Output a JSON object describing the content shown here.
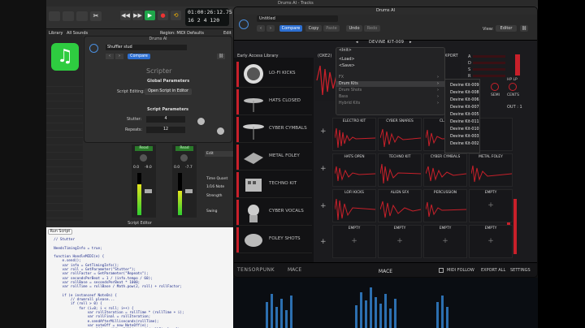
{
  "menubar": {
    "title": "Drums AI - Tracks"
  },
  "daw": {
    "lcd_time": "01:00:26:12.75",
    "lcd_sub": "16  2  4 120",
    "library_label": "Library",
    "all_sounds": "All Sounds",
    "region_label": "Region: MIDI Defaults",
    "edit_label": "Edit",
    "read1": "Read",
    "read2": "Read",
    "val1": "0.0",
    "val2": "-9.0",
    "val3": "0.0",
    "val4": "-7.7",
    "side_time_quant": "Time Quant",
    "side_note": "1/16 Note",
    "side_strength": "Strength",
    "side_swing": "Swing"
  },
  "scripter": {
    "window_title": "Drums AI",
    "preset": "Shuffler stud",
    "compare": "Compare",
    "heading": "Scripter",
    "global_params": "Global Parameters",
    "script_editing_label": "Script Editing:",
    "open_script_btn": "Open Script in Editor",
    "script_params": "Script Parameters",
    "stutter_label": "Stutter:",
    "stutter_value": "4",
    "repeats_label": "Repeats:",
    "repeats_value": "12"
  },
  "script_editor": {
    "title": "Script Editor",
    "run_button": "Run Script",
    "code": "  // Stutter\n\n  NeedsTimingInfo = true;\n\n  function HandleMIDI(e) {\n      e.send();\n      var info = GetTimingInfo();\n      var roll = GetParameter(\"Stutter\");\n      var rollFactor = GetParameter(\"Repeats\");\n      var secondsPerBeat = 1 / (info.tempo / 60);\n      var rollBase = secondsPerBeat * 1000;\n      var rollTime = rollBase / Math.pow(2, roll) + rollFactor;\n\n      if (e instanceof NoteOn) {\n          // drumroll please...\n          if (roll > 0) {\n              for (i=0; i < roll; i++) {\n                  var rollIteration = rollTime * (rollTime + i);\n                  var rollFinal = rollIteration;\n                  e.sendAfterMilliseconds(rollTime);\n                  var noteOff = new NoteOff(e);\n                  noteOff.sendAfterMilliseconds(rollFinal + 1);"
  },
  "plugin": {
    "window_title": "Drums AI",
    "preset": "Untitled",
    "compare": "Compare",
    "copy": "Copy",
    "paste": "Paste",
    "undo": "Undo",
    "redo": "Redo",
    "view_label": "View:",
    "view_value": "Editor",
    "kit_name": "DEVINE KIT-009",
    "early_access": "Early Access Library",
    "kit_slot": "(OXE2)",
    "export": "EXPORT",
    "adsr": [
      "A",
      "D",
      "S",
      "R"
    ],
    "hp_lp": "HP LP",
    "knobs": [
      "SEMI",
      "CENTS"
    ],
    "out": "OUT : 1",
    "categories": [
      {
        "label": "LO-FI KICKS",
        "icon": "drum-icon"
      },
      {
        "label": "HATS CLOSED",
        "icon": "hihat-icon"
      },
      {
        "label": "CYBER CYMBALS",
        "icon": "cymbal-icon"
      },
      {
        "label": "METAL FOLEY",
        "icon": "metal-icon"
      },
      {
        "label": "TECHNO KIT",
        "icon": "drum-machine-icon"
      },
      {
        "label": "CYBER VOCALS",
        "icon": "head-icon"
      },
      {
        "label": "FOLEY SHOTS",
        "icon": "foley-icon"
      }
    ],
    "pads": [
      {
        "name": "ELECTRO KIT"
      },
      {
        "name": "CYBER SNARES"
      },
      {
        "name": "CLAPS"
      },
      {
        "name": ""
      },
      {
        "name": "HATS OPEN"
      },
      {
        "name": "TECHNO KIT"
      },
      {
        "name": "CYBER CYMBALS"
      },
      {
        "name": "METAL FOLEY"
      },
      {
        "name": "LOFI KICKS"
      },
      {
        "name": "ALIEN SFX"
      },
      {
        "name": "PERCUSSION"
      },
      {
        "name": "EMPTY"
      },
      {
        "name": "EMPTY"
      },
      {
        "name": "EMPTY"
      },
      {
        "name": "EMPTY"
      },
      {
        "name": "EMPTY"
      }
    ],
    "brand": "TENSORPUNK",
    "brand2": "MACE",
    "midi_follow": "MIDI FOLLOW",
    "export_all": "EXPORT ALL",
    "settings": "SETTINGS",
    "bottom_title": "MACE"
  },
  "menu": {
    "items": [
      "<Init>",
      "<Load>",
      "<Save>",
      "FX",
      "Drum Kits",
      "Drum Shots",
      "Bass",
      "Hybrid Kits"
    ],
    "submenu": [
      "Devine Kit-009",
      "Devine Kit-008",
      "Devine Kit-006",
      "Devine Kit-007",
      "Devine Kit-005",
      "Devine Kit-011",
      "Devine Kit-010",
      "Devine Kit-003",
      "Devine Kit-002"
    ]
  },
  "colors": {
    "accent_red": "#c8202a",
    "brand_blue": "#3a7bd5"
  }
}
